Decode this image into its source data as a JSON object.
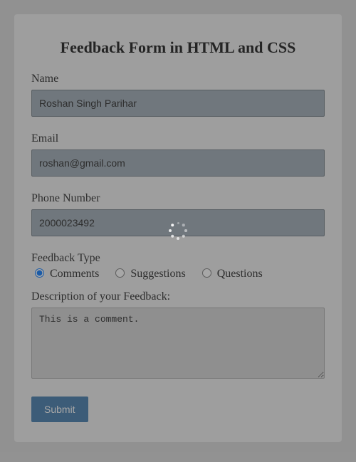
{
  "form": {
    "title": "Feedback Form in HTML and CSS",
    "name_label": "Name",
    "name_value": "Roshan Singh Parihar",
    "email_label": "Email",
    "email_value": "roshan@gmail.com",
    "phone_label": "Phone Number",
    "phone_value": "2000023492",
    "feedback_type_label": "Feedback Type",
    "feedback_types": {
      "comments": "Comments",
      "suggestions": "Suggestions",
      "questions": "Questions"
    },
    "selected_feedback_type": "comments",
    "description_label": "Description of your Feedback:",
    "description_value": "This is a comment.",
    "submit_label": "Submit"
  },
  "overlay": {
    "loading": true
  }
}
